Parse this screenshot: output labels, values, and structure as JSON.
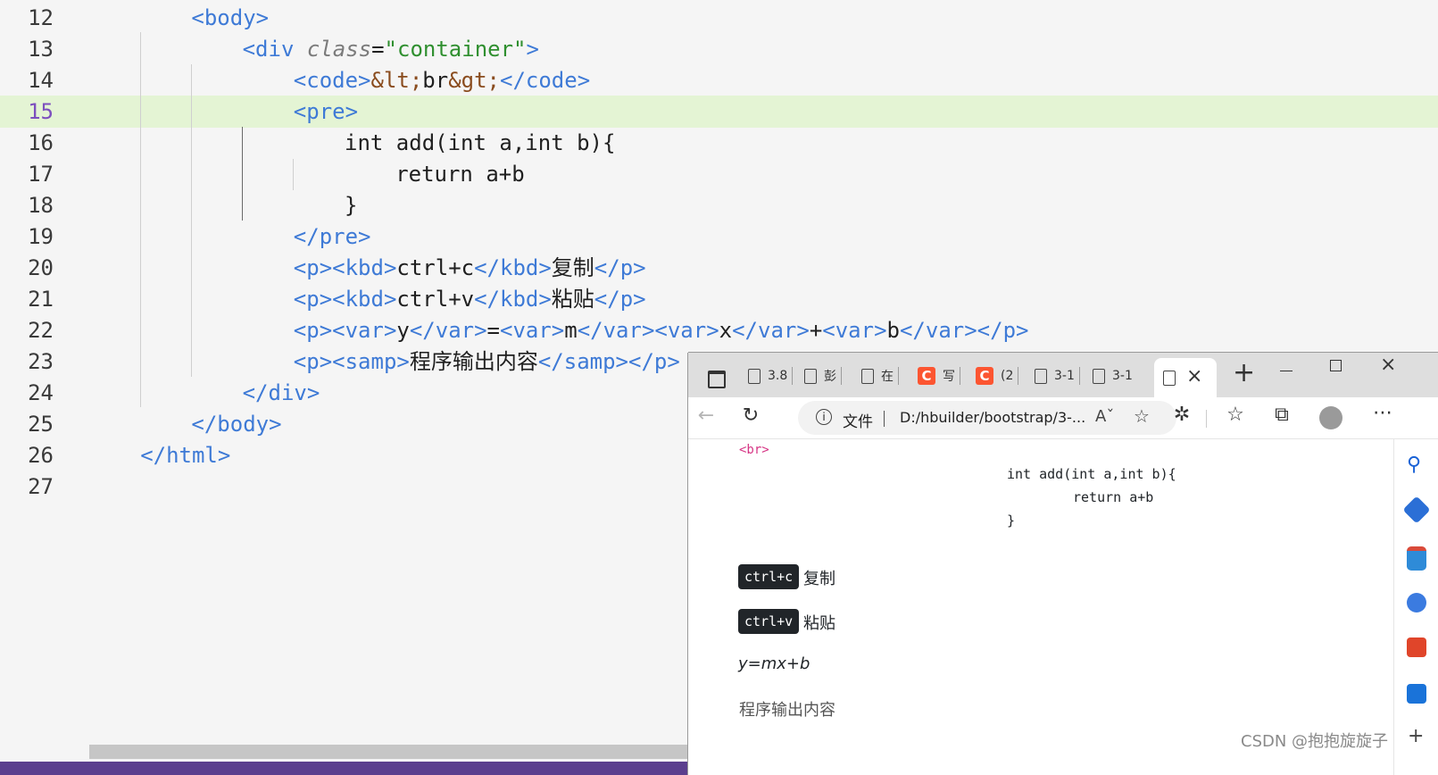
{
  "editor": {
    "active_line": "15",
    "lines": [
      {
        "num": "12",
        "parts": [
          {
            "c": "t",
            "x": "<body>"
          }
        ]
      },
      {
        "num": "13",
        "parts": [
          {
            "c": "t",
            "x": "<div "
          },
          {
            "c": "a",
            "x": "class"
          },
          {
            "c": "",
            "x": "="
          },
          {
            "c": "s",
            "x": "\"container\""
          },
          {
            "c": "t",
            "x": ">"
          }
        ]
      },
      {
        "num": "14",
        "parts": [
          {
            "c": "t",
            "x": "<code>"
          },
          {
            "c": "e",
            "x": "&lt;"
          },
          {
            "c": "",
            "x": "br"
          },
          {
            "c": "e",
            "x": "&gt;"
          },
          {
            "c": "t",
            "x": "</code>"
          }
        ]
      },
      {
        "num": "15",
        "parts": [
          {
            "c": "t",
            "x": "<pre>"
          }
        ]
      },
      {
        "num": "16",
        "parts": [
          {
            "c": "",
            "x": "int add(int a,int b){"
          }
        ]
      },
      {
        "num": "17",
        "parts": [
          {
            "c": "",
            "x": "return a+b"
          }
        ]
      },
      {
        "num": "18",
        "parts": [
          {
            "c": "",
            "x": "}"
          }
        ]
      },
      {
        "num": "19",
        "parts": [
          {
            "c": "t",
            "x": "</pre>"
          }
        ]
      },
      {
        "num": "20",
        "parts": [
          {
            "c": "t",
            "x": "<p><kbd>"
          },
          {
            "c": "",
            "x": "ctrl+c"
          },
          {
            "c": "t",
            "x": "</kbd>"
          },
          {
            "c": "",
            "x": "复制"
          },
          {
            "c": "t",
            "x": "</p>"
          }
        ]
      },
      {
        "num": "21",
        "parts": [
          {
            "c": "t",
            "x": "<p><kbd>"
          },
          {
            "c": "",
            "x": "ctrl+v"
          },
          {
            "c": "t",
            "x": "</kbd>"
          },
          {
            "c": "",
            "x": "粘贴"
          },
          {
            "c": "t",
            "x": "</p>"
          }
        ]
      },
      {
        "num": "22",
        "parts": [
          {
            "c": "t",
            "x": "<p><var>"
          },
          {
            "c": "",
            "x": "y"
          },
          {
            "c": "t",
            "x": "</var>"
          },
          {
            "c": "",
            "x": "="
          },
          {
            "c": "t",
            "x": "<var>"
          },
          {
            "c": "",
            "x": "m"
          },
          {
            "c": "t",
            "x": "</var><var>"
          },
          {
            "c": "",
            "x": "x"
          },
          {
            "c": "t",
            "x": "</var>"
          },
          {
            "c": "",
            "x": "+"
          },
          {
            "c": "t",
            "x": "<var>"
          },
          {
            "c": "",
            "x": "b"
          },
          {
            "c": "t",
            "x": "</var></p>"
          }
        ]
      },
      {
        "num": "23",
        "parts": [
          {
            "c": "t",
            "x": "<p><samp>"
          },
          {
            "c": "",
            "x": "程序输出内容"
          },
          {
            "c": "t",
            "x": "</samp></p>"
          }
        ]
      },
      {
        "num": "24",
        "parts": [
          {
            "c": "t",
            "x": "</div>"
          }
        ]
      },
      {
        "num": "25",
        "parts": [
          {
            "c": "t",
            "x": "</body>"
          }
        ]
      },
      {
        "num": "26",
        "parts": [
          {
            "c": "t",
            "x": "</html>"
          }
        ]
      },
      {
        "num": "27",
        "parts": []
      }
    ]
  },
  "browser": {
    "tabs": [
      "3.8",
      "彭",
      "在",
      "写",
      "(2",
      "3-1",
      "3-1"
    ],
    "address_info_label": "文件",
    "address_url": "D:/hbuilder/bootstrap/3-...",
    "close_tab_glyph": "×",
    "new_tab_glyph": "+",
    "page": {
      "code_text": "<br>",
      "pre_lines": [
        "int add(int a,int b){",
        "return a+b",
        "}"
      ],
      "kbd1": "ctrl+c",
      "kbd1_text": "复制",
      "kbd2": "ctrl+v",
      "kbd2_text": "粘贴",
      "var_line": "y=mx+b",
      "samp_text": "程序输出内容"
    },
    "colors": {
      "code_pink": "#d63384",
      "kbd_bg": "#212529",
      "csdn": "#fc5531"
    }
  },
  "watermark": "CSDN @抱抱旋旋子"
}
